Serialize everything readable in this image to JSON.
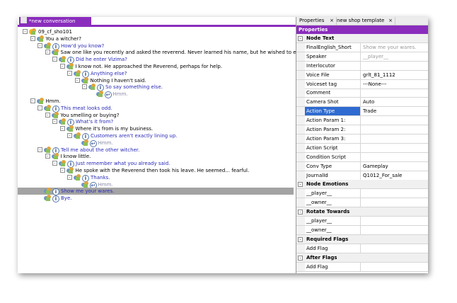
{
  "document_tab": {
    "title": "*new conversation"
  },
  "tree": [
    {
      "text": "09_cf_sho101",
      "type": "root",
      "indent": 0,
      "blue": false,
      "expander": "-"
    },
    {
      "text": "You a witcher?",
      "type": "npc",
      "indent": 1,
      "blue": false,
      "expander": "-"
    },
    {
      "text": "How'd you know?",
      "type": "player",
      "indent": 2,
      "blue": true,
      "expander": "-"
    },
    {
      "text": "Saw one like you recently and asked the reverend. Never learned his name, but he wished to enter the city.",
      "type": "npc",
      "indent": 3,
      "blue": false,
      "expander": "-"
    },
    {
      "text": "Did he enter Vizima?",
      "type": "player",
      "indent": 4,
      "blue": true,
      "expander": "-"
    },
    {
      "text": "I know not. He approached the Reverend, perhaps for help.",
      "type": "npc",
      "indent": 5,
      "blue": false,
      "expander": "-"
    },
    {
      "text": "Anything else?",
      "type": "player",
      "indent": 6,
      "blue": true,
      "expander": "-"
    },
    {
      "text": "Nothing I haven't said.",
      "type": "npc",
      "indent": 7,
      "blue": false,
      "expander": "-"
    },
    {
      "text": "So say something else.",
      "type": "player",
      "indent": 8,
      "blue": true,
      "expander": "-"
    },
    {
      "text": "Hmm.",
      "type": "link",
      "indent": 9,
      "blue": false,
      "expander": ""
    },
    {
      "text": "Hmm.",
      "type": "npc",
      "indent": 1,
      "blue": false,
      "expander": "-"
    },
    {
      "text": "This meat looks odd.",
      "type": "player",
      "indent": 2,
      "blue": true,
      "expander": "-"
    },
    {
      "text": "You smelling or buying?",
      "type": "npc",
      "indent": 3,
      "blue": false,
      "expander": "-"
    },
    {
      "text": "What's it from?",
      "type": "player",
      "indent": 4,
      "blue": true,
      "expander": "-"
    },
    {
      "text": "Where it's from is my business.",
      "type": "npc",
      "indent": 5,
      "blue": false,
      "expander": "-"
    },
    {
      "text": "Customers aren't exactly lining up.",
      "type": "player",
      "indent": 6,
      "blue": true,
      "expander": "-"
    },
    {
      "text": "Hmm.",
      "type": "link",
      "indent": 7,
      "blue": false,
      "expander": ""
    },
    {
      "text": "Tell me about the other witcher.",
      "type": "player",
      "indent": 2,
      "blue": true,
      "expander": "-"
    },
    {
      "text": "I know little.",
      "type": "npc",
      "indent": 3,
      "blue": false,
      "expander": "-"
    },
    {
      "text": "Just remember what you already said.",
      "type": "player",
      "indent": 4,
      "blue": true,
      "expander": "-"
    },
    {
      "text": "He spoke with the Reverend then took his leave. He seemed... fearful.",
      "type": "npc",
      "indent": 5,
      "blue": false,
      "expander": "-"
    },
    {
      "text": "Thanks.",
      "type": "player",
      "indent": 6,
      "blue": true,
      "expander": "-"
    },
    {
      "text": "Hmm.",
      "type": "link",
      "indent": 7,
      "blue": false,
      "expander": ""
    },
    {
      "text": "Show me your wares.",
      "type": "player",
      "indent": 2,
      "blue": true,
      "expander": "",
      "selected": true
    },
    {
      "text": "Bye.",
      "type": "player",
      "indent": 2,
      "blue": true,
      "expander": ""
    }
  ],
  "right_tabs": [
    {
      "label": "Properties",
      "close": "×"
    },
    {
      "label": "new shop template",
      "close": "×"
    }
  ],
  "properties_header": "Properties",
  "properties": [
    {
      "cat": true,
      "label": "Node Text",
      "toggle": "-"
    },
    {
      "label": "FinalEnglish_Short",
      "value": "Show me your wares.",
      "placeholder": true
    },
    {
      "label": "Speaker",
      "value": "__player__",
      "placeholder": true
    },
    {
      "label": "Interlocutor",
      "value": ""
    },
    {
      "label": "Voice File",
      "value": "grlt_81_1112"
    },
    {
      "label": "Voiceset tag",
      "value": "---None---"
    },
    {
      "label": "Comment",
      "value": ""
    },
    {
      "label": "Camera Shot",
      "value": "Auto"
    },
    {
      "label": "Action Type",
      "value": "Trade",
      "highlight": true
    },
    {
      "label": "Action Param 1:",
      "value": ""
    },
    {
      "label": "Action Param 2:",
      "value": ""
    },
    {
      "label": "Action Param 3:",
      "value": ""
    },
    {
      "label": "Action Script",
      "value": ""
    },
    {
      "label": "Condition Script",
      "value": ""
    },
    {
      "label": "Conv Type",
      "value": "Gameplay"
    },
    {
      "label": "JournalId",
      "value": "Q1012_For_sale"
    },
    {
      "cat": true,
      "label": "Node Emotions",
      "toggle": "-"
    },
    {
      "label": "__player__",
      "value": ""
    },
    {
      "label": "__owner__",
      "value": ""
    },
    {
      "cat": true,
      "label": "Rotate Towards",
      "toggle": "-"
    },
    {
      "label": "__player__",
      "value": ""
    },
    {
      "label": "__owner__",
      "value": ""
    },
    {
      "cat": true,
      "label": "Required Flags",
      "toggle": "-"
    },
    {
      "label": "Add Flag",
      "value": ""
    },
    {
      "cat": true,
      "label": "After Flags",
      "toggle": "-"
    },
    {
      "label": "Add Flag",
      "value": ""
    }
  ]
}
